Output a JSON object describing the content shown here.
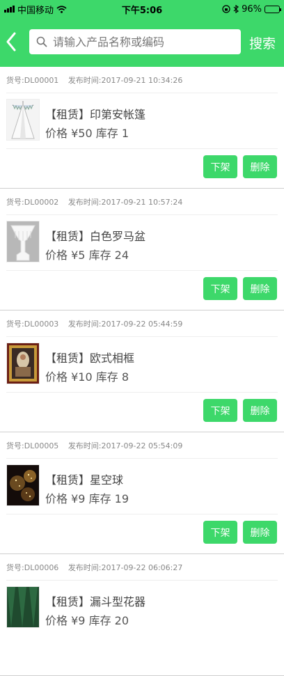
{
  "status_bar": {
    "carrier": "中国移动",
    "time": "下午5:06",
    "battery": "96%"
  },
  "header": {
    "search_placeholder": "请输入产品名称或编码",
    "search_label": "搜索"
  },
  "labels": {
    "code_prefix": "货号:",
    "publish_prefix": "发布时间:",
    "price_label": "价格",
    "stock_label": "库存",
    "unshelve_button": "下架",
    "delete_button": "删除"
  },
  "products": [
    {
      "code": "DL00001",
      "published": "2017-09-21 10:34:26",
      "title": "【租赁】印第安帐篷",
      "price": "¥50",
      "stock": "1"
    },
    {
      "code": "DL00002",
      "published": "2017-09-21 10:57:24",
      "title": "【租赁】白色罗马盆",
      "price": "¥5",
      "stock": "24"
    },
    {
      "code": "DL00003",
      "published": "2017-09-22 05:44:59",
      "title": "【租赁】欧式相框",
      "price": "¥10",
      "stock": "8"
    },
    {
      "code": "DL00005",
      "published": "2017-09-22 05:54:09",
      "title": "【租赁】星空球",
      "price": "¥9",
      "stock": "19"
    },
    {
      "code": "DL00006",
      "published": "2017-09-22 06:06:27",
      "title": "【租赁】漏斗型花器",
      "price": "¥9",
      "stock": "20"
    }
  ]
}
